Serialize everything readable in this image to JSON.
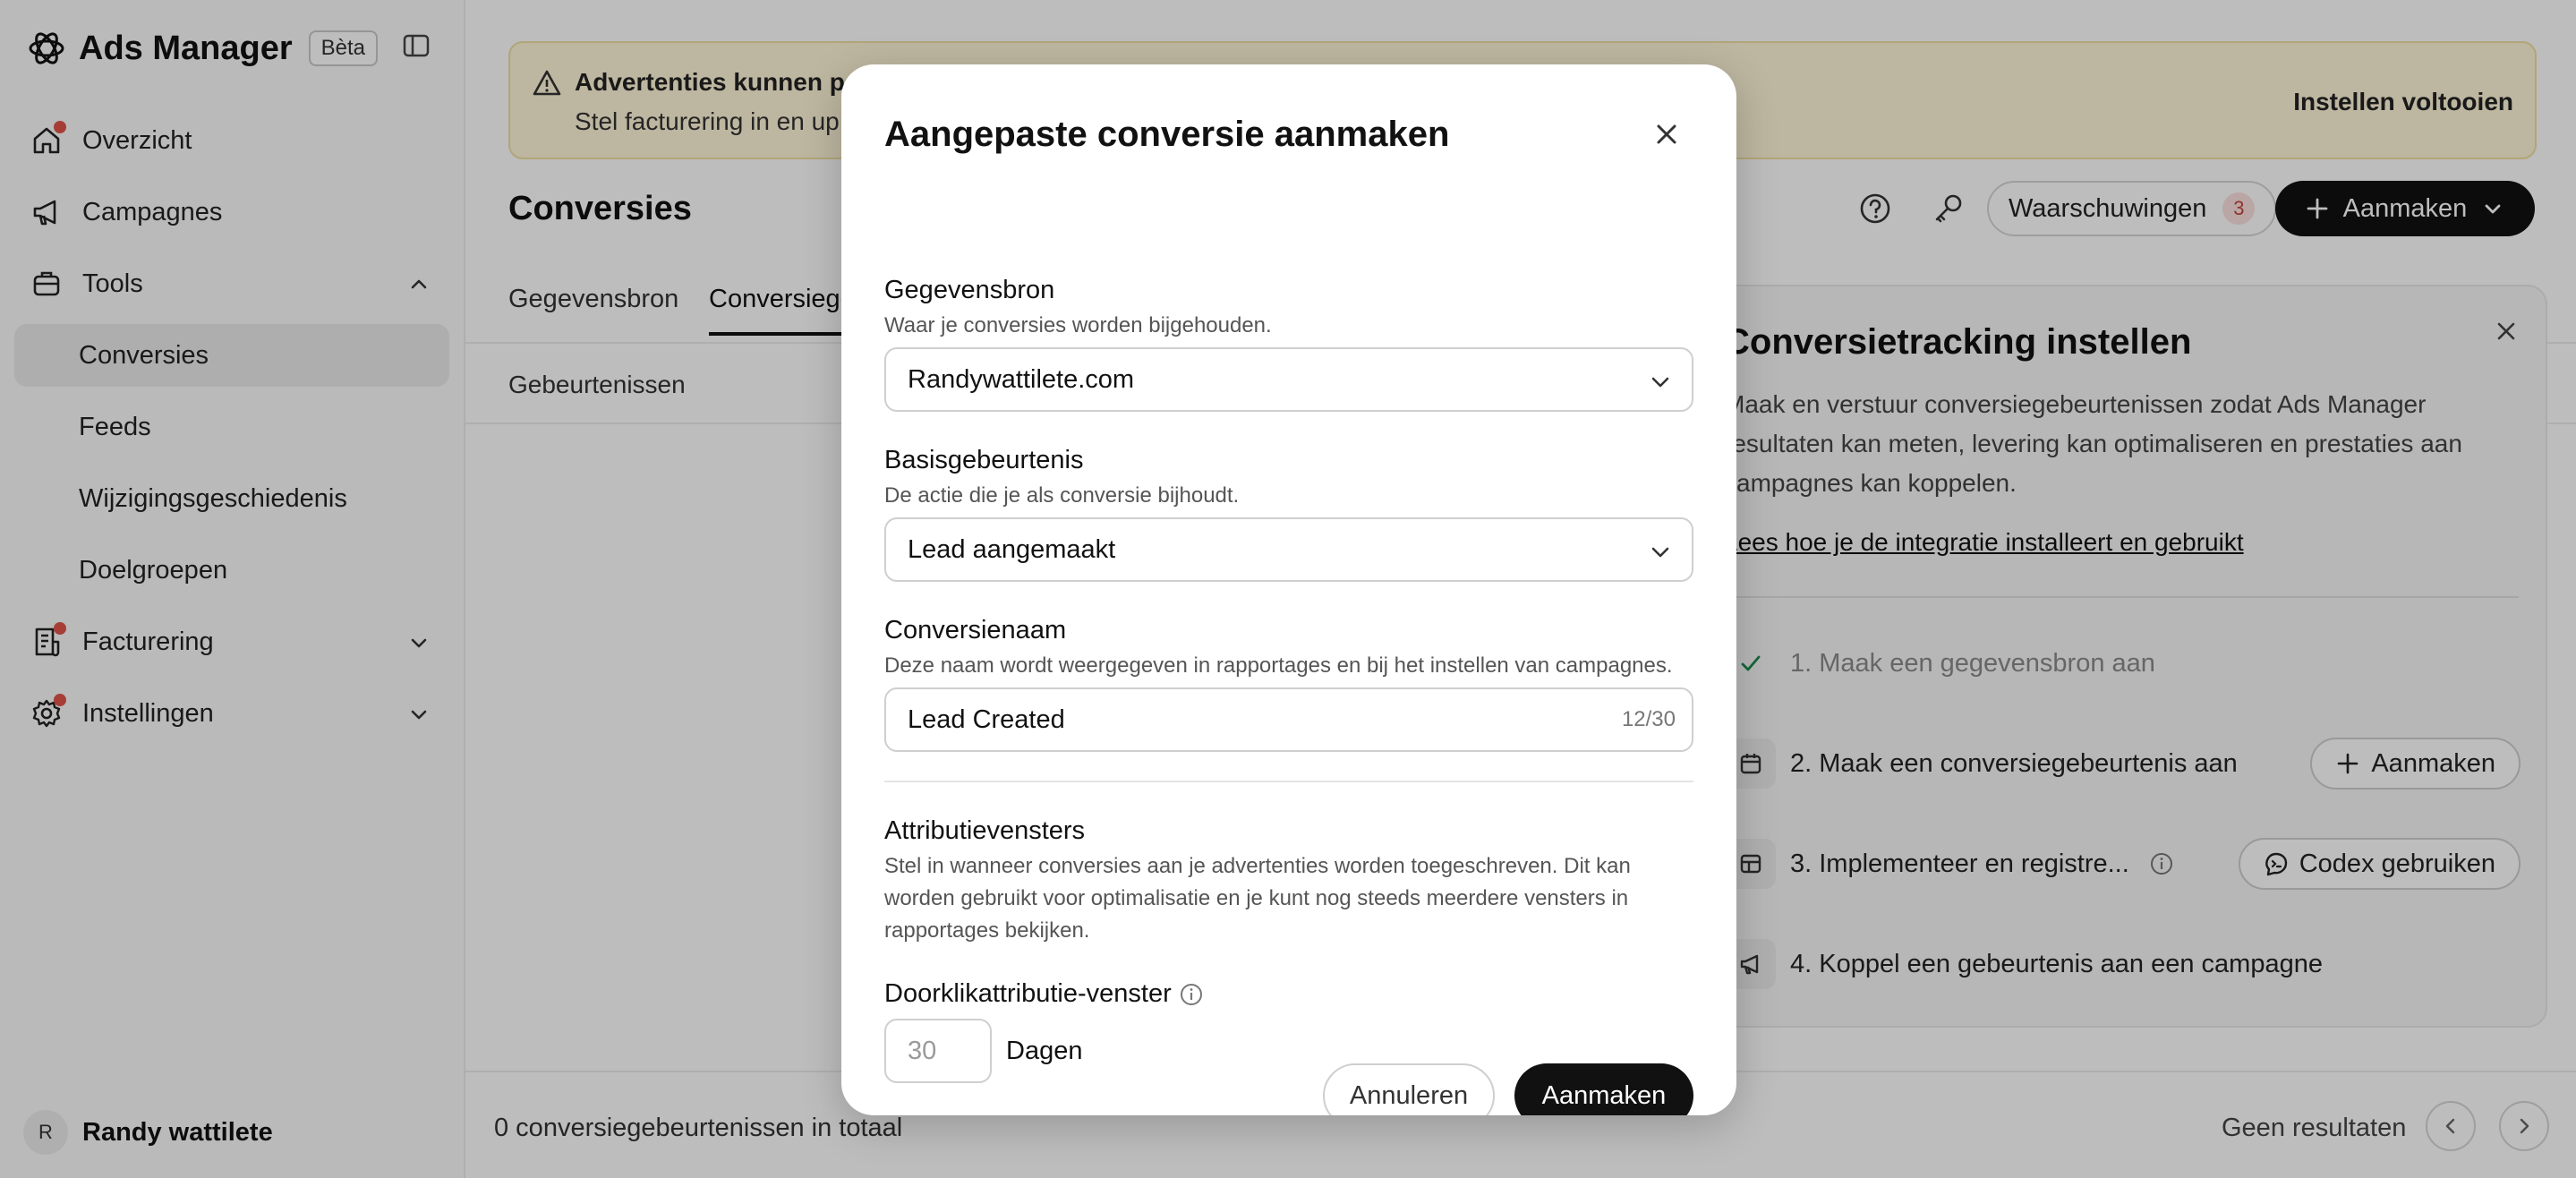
{
  "sidebar": {
    "app_name": "Ads Manager",
    "beta": "Bèta",
    "nav": {
      "overzicht": "Overzicht",
      "campagnes": "Campagnes",
      "tools": "Tools",
      "conversies": "Conversies",
      "feeds": "Feeds",
      "wijzigingsgeschiedenis": "Wijzigingsgeschiedenis",
      "doelgroepen": "Doelgroepen",
      "facturering": "Facturering",
      "instellingen": "Instellingen"
    },
    "user": {
      "initial": "R",
      "name": "Randy wattilete"
    }
  },
  "banner": {
    "title": "Advertenties kunnen pa",
    "text": "Stel facturering in en up",
    "action": "Instellen voltooien"
  },
  "header": {
    "title": "Conversies",
    "warnings_label": "Waarschuwingen",
    "warnings_count": "3",
    "create_label": "Aanmaken"
  },
  "tabs": {
    "gegevensbron": "Gegevensbron",
    "conversies": "Conversiege"
  },
  "subtabs": {
    "gebeurtenissen": "Gebeurtenissen"
  },
  "footer": {
    "total": "0 conversiegebeurtenissen in totaal",
    "results": "Geen resultaten"
  },
  "panel": {
    "title": "Conversietracking instellen",
    "desc": "Maak en verstuur conversiegebeurtenissen zodat Ads Manager resultaten kan meten, levering kan optimaliseren en prestaties aan campagnes kan koppelen.",
    "link": "Lees hoe je de integratie installeert en gebruikt",
    "steps": {
      "s1": "1. Maak een gegevensbron aan",
      "s2": "2. Maak een conversiegebeurtenis aan",
      "s2_button": "Aanmaken",
      "s3": "3. Implementeer en registre...",
      "s3_button": "Codex gebruiken",
      "s4": "4. Koppel een gebeurtenis aan een campagne"
    }
  },
  "modal": {
    "title": "Aangepaste conversie aanmaken",
    "source": {
      "label": "Gegevensbron",
      "hint": "Waar je conversies worden bijgehouden.",
      "value": "Randywattilete.com"
    },
    "event": {
      "label": "Basisgebeurtenis",
      "hint": "De actie die je als conversie bijhoudt.",
      "value": "Lead aangemaakt"
    },
    "name": {
      "label": "Conversienaam",
      "hint": "Deze naam wordt weergegeven in rapportages en bij het instellen van campagnes.",
      "value": "Lead Created",
      "count": "12/30"
    },
    "attribution": {
      "label": "Attributievensters",
      "hint": "Stel in wanneer conversies aan je advertenties worden toegeschreven. Dit kan worden gebruikt voor optimalisatie en je kunt nog steeds meerdere vensters in rapportages bekijken."
    },
    "click_window": {
      "label": "Doorklikattributie-venster",
      "placeholder": "30",
      "unit": "Dagen"
    },
    "cancel_label": "Annuleren",
    "create_label": "Aanmaken"
  },
  "colors": {
    "accent": "#111111",
    "notification_dot": "#e0534a",
    "banner_bg": "#fff6d8"
  }
}
